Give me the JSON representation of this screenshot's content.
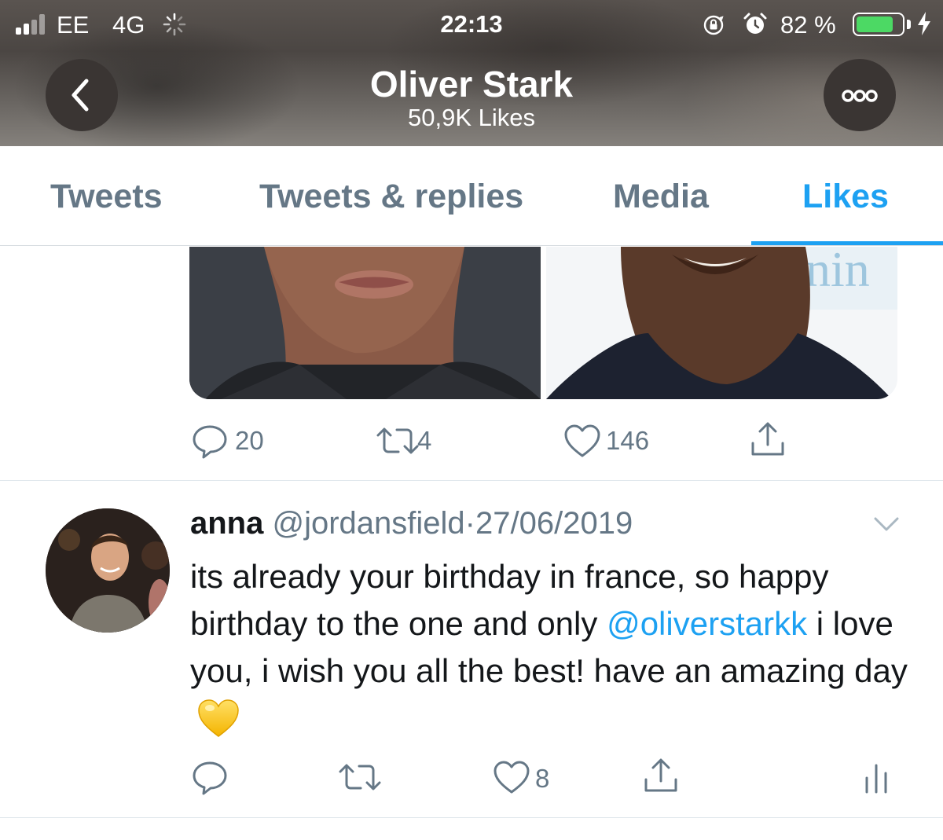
{
  "status_bar": {
    "carrier": "EE",
    "network": "4G",
    "time": "22:13",
    "battery_percent": "82 %",
    "battery_level": 0.82,
    "colors": {
      "battery_fill": "#4cd964"
    }
  },
  "header": {
    "title": "Oliver Stark",
    "subtitle": "50,9K Likes",
    "back_icon": "chevron-left-icon",
    "more_icon": "more-horizontal-icon"
  },
  "tabs": [
    {
      "label": "Tweets",
      "active": false
    },
    {
      "label": "Tweets & replies",
      "active": false
    },
    {
      "label": "Media",
      "active": false
    },
    {
      "label": "Likes",
      "active": true
    }
  ],
  "previous_tweet": {
    "actions": {
      "reply_count": "20",
      "retweet_count": "4",
      "like_count": "146"
    }
  },
  "tweet": {
    "name": "anna",
    "handle": "@jordansfield",
    "separator": "·",
    "date": "27/06/2019",
    "text_before": "its already your birthday in france, so happy birthday to the one and only",
    "mention": "@oliverstarkk",
    "text_after": "i love you, i wish you all the best! have an amazing day",
    "emoji": "yellow-heart",
    "actions": {
      "reply_count": "",
      "retweet_count": "",
      "like_count": "8"
    }
  },
  "colors": {
    "accent": "#1da1f2",
    "secondary_text": "#657786",
    "primary_text": "#14171a"
  }
}
